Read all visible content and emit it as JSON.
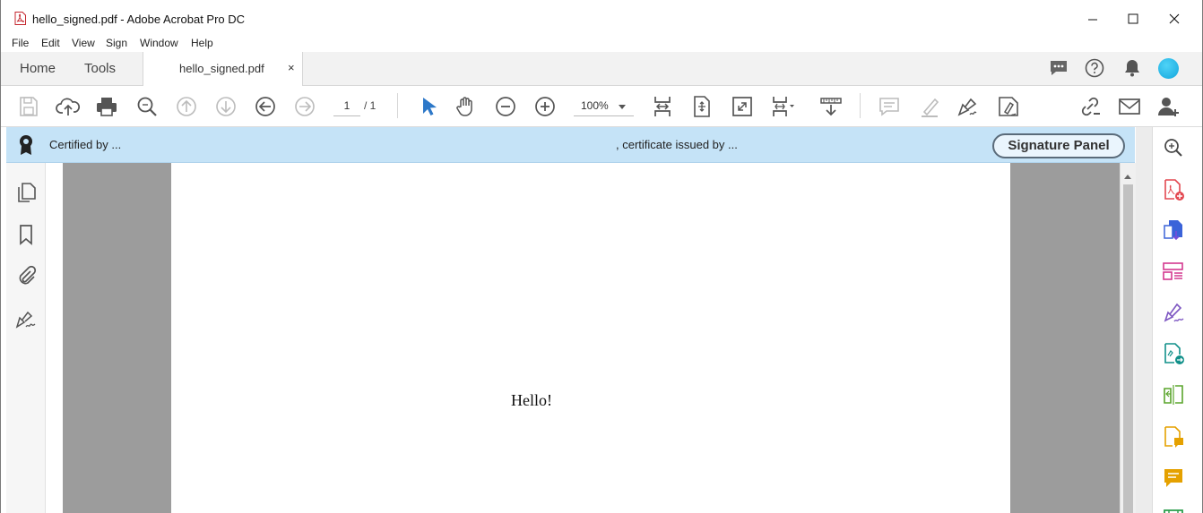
{
  "window": {
    "title": "hello_signed.pdf - Adobe Acrobat Pro DC"
  },
  "menu": {
    "items": [
      "File",
      "Edit",
      "View",
      "Sign",
      "Window",
      "Help"
    ]
  },
  "tabs": {
    "home": "Home",
    "tools": "Tools",
    "document": "hello_signed.pdf",
    "close_glyph": "×"
  },
  "toolbar": {
    "page_current": "1",
    "page_total": "/ 1",
    "zoom": "100%",
    "icons": [
      "save-icon",
      "upload-icon",
      "print-icon",
      "search-icon",
      "prev-page-up-icon",
      "next-page-down-icon",
      "back-icon",
      "forward-icon",
      "select-cursor-icon",
      "hand-icon",
      "zoom-out-icon",
      "zoom-in-icon",
      "fit-width-icon",
      "fit-page-icon",
      "full-screen-icon",
      "page-display-icon",
      "scroll-mode-icon",
      "comment-icon",
      "highlight-icon",
      "fill-sign-icon",
      "protect-sign-icon",
      "share-link-icon",
      "email-icon",
      "add-user-icon"
    ]
  },
  "signature_bar": {
    "certified_by": "Certified by  ...",
    "issued_by": ", certificate issued by  ...",
    "button": "Signature Panel"
  },
  "document": {
    "text": "Hello!"
  },
  "colors": {
    "banner": "#c5e3f7",
    "accent_blue": "#2d78c8",
    "doc_background": "#9c9c9c"
  }
}
